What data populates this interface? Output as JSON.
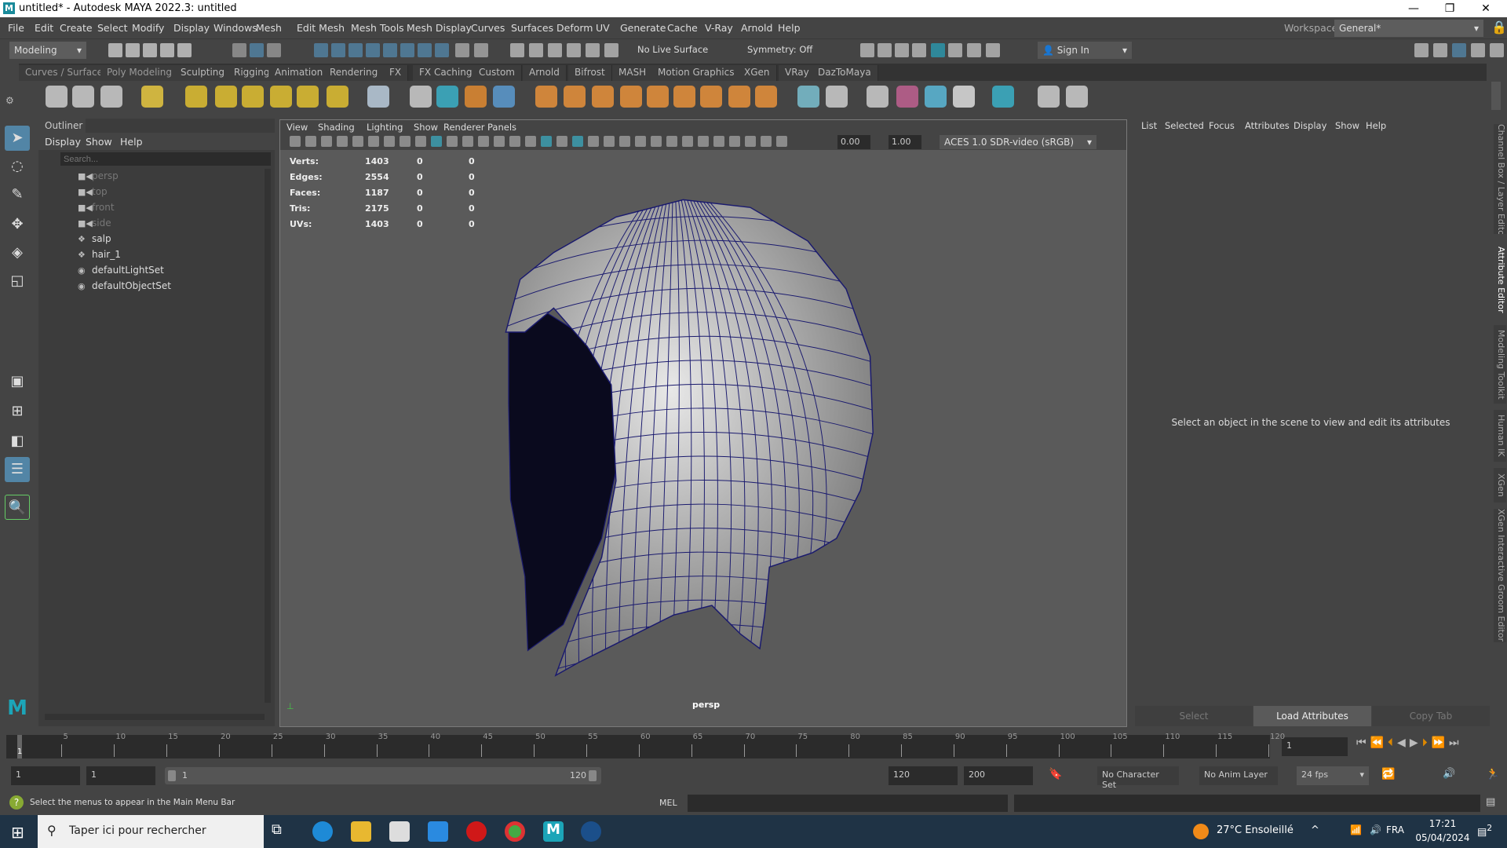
{
  "window": {
    "title": "untitled* - Autodesk MAYA 2022.3: untitled",
    "logo": "M",
    "minimize": "—",
    "restore": "❐",
    "close": "✕"
  },
  "menubar": {
    "items": [
      "File",
      "Edit",
      "Create",
      "Select",
      "Modify",
      "Display",
      "Windows",
      "Mesh",
      "Edit Mesh",
      "Mesh Tools",
      "Mesh Display",
      "Curves",
      "Surfaces",
      "Deform",
      "UV",
      "Generate",
      "Cache",
      "V-Ray",
      "Arnold",
      "Help"
    ],
    "workspace_label": "Workspace:",
    "workspace_value": "General*"
  },
  "statusline": {
    "menuset": "Modeling",
    "live_surface": "No Live Surface",
    "symmetry": "Symmetry: Off",
    "sign_in": "Sign In"
  },
  "shelf": {
    "tabs": [
      "Curves / Surfaces",
      "Poly Modeling",
      "Sculpting",
      "Rigging",
      "Animation",
      "Rendering",
      "FX",
      "FX Caching",
      "Custom",
      "Arnold",
      "Bifrost",
      "MASH",
      "Motion Graphics",
      "XGen",
      "VRay",
      "DazToMaya"
    ]
  },
  "outliner": {
    "title": "Outliner",
    "menus": [
      "Display",
      "Show",
      "Help"
    ],
    "search_placeholder": "Search...",
    "items": [
      {
        "label": "persp",
        "type": "camera",
        "dim": true
      },
      {
        "label": "top",
        "type": "camera",
        "dim": true
      },
      {
        "label": "front",
        "type": "camera",
        "dim": true
      },
      {
        "label": "side",
        "type": "camera",
        "dim": true
      },
      {
        "label": "salp",
        "type": "mesh",
        "dim": false
      },
      {
        "label": "hair_1",
        "type": "mesh",
        "dim": false
      },
      {
        "label": "defaultLightSet",
        "type": "set",
        "dim": false
      },
      {
        "label": "defaultObjectSet",
        "type": "set",
        "dim": false
      }
    ]
  },
  "viewport": {
    "menus": [
      "View",
      "Shading",
      "Lighting",
      "Show",
      "Renderer",
      "Panels"
    ],
    "exposure": "0.00",
    "gamma": "1.00",
    "color_space": "ACES 1.0 SDR-video (sRGB)",
    "camera": "persp",
    "hud": [
      {
        "label": "Verts:",
        "v": [
          "1403",
          "0",
          "0"
        ]
      },
      {
        "label": "Edges:",
        "v": [
          "2554",
          "0",
          "0"
        ]
      },
      {
        "label": "Faces:",
        "v": [
          "1187",
          "0",
          "0"
        ]
      },
      {
        "label": "Tris:",
        "v": [
          "2175",
          "0",
          "0"
        ]
      },
      {
        "label": "UVs:",
        "v": [
          "1403",
          "0",
          "0"
        ]
      }
    ]
  },
  "attribute_editor": {
    "menus": [
      "List",
      "Selected",
      "Focus",
      "Attributes",
      "Display",
      "Show",
      "Help"
    ],
    "message": "Select an object in the scene to view and edit its attributes",
    "buttons": [
      "Select",
      "Load Attributes",
      "Copy Tab"
    ]
  },
  "side_tabs": [
    "Channel Box / Layer Editor",
    "Attribute Editor",
    "Modeling Toolkit",
    "Human IK",
    "XGen",
    "XGen Interactive Groom Editor"
  ],
  "timeline": {
    "ticks": [
      5,
      10,
      15,
      20,
      25,
      30,
      35,
      40,
      45,
      50,
      55,
      60,
      65,
      70,
      75,
      80,
      85,
      90,
      95,
      100,
      105,
      110,
      115,
      120
    ],
    "current_frame_marker": "1",
    "current_frame": "1"
  },
  "range": {
    "start": "1",
    "playback_start": "1",
    "slider_start": "1",
    "slider_end": "120",
    "playback_end": "120",
    "end": "200",
    "character_set": "No Character Set",
    "anim_layer": "No Anim Layer",
    "fps": "24 fps"
  },
  "commandline": {
    "help": "Select the menus to appear in the Main Menu Bar",
    "lang": "MEL"
  },
  "taskbar": {
    "search_placeholder": "Taper ici pour rechercher",
    "weather": "27°C  Ensoleillé",
    "lang": "FRA",
    "time": "17:21",
    "date": "05/04/2024",
    "notifications": "2"
  },
  "colors": {
    "accent": "#5285a6",
    "hair_wire": "#1a1a6e"
  }
}
